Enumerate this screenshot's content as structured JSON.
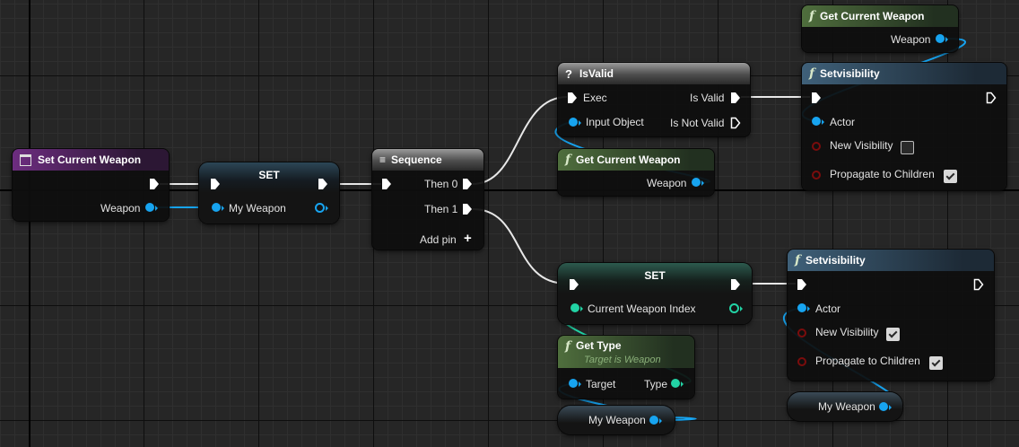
{
  "nodes": {
    "set_current_weapon_event": {
      "title": "Set Current Weapon",
      "icon": "event-icon",
      "out_pin": "Weapon"
    },
    "set_my_weapon": {
      "title": "SET",
      "in_pin": "My Weapon"
    },
    "sequence": {
      "title": "Sequence",
      "icon": "sequence-icon",
      "then0": "Then 0",
      "then1": "Then 1",
      "add_pin": "Add pin"
    },
    "is_valid": {
      "title": "IsValid",
      "icon": "question-icon",
      "exec": "Exec",
      "input_object": "Input Object",
      "is_valid": "Is Valid",
      "is_not_valid": "Is Not Valid"
    },
    "get_current_weapon_1": {
      "title": "Get Current Weapon",
      "icon": "function-icon",
      "out_pin": "Weapon"
    },
    "get_current_weapon_2": {
      "title": "Get Current Weapon",
      "icon": "function-icon",
      "out_pin": "Weapon"
    },
    "set_visibility_1": {
      "title": "Setvisibility",
      "icon": "function-icon",
      "actor": "Actor",
      "new_visibility": "New Visibility",
      "new_visibility_checked": false,
      "propagate": "Propagate to Children",
      "propagate_checked": true
    },
    "set_weapon_index": {
      "title": "SET",
      "in_pin": "Current Weapon Index"
    },
    "set_visibility_2": {
      "title": "Setvisibility",
      "icon": "function-icon",
      "actor": "Actor",
      "new_visibility": "New Visibility",
      "new_visibility_checked": true,
      "propagate": "Propagate to Children",
      "propagate_checked": true
    },
    "get_type": {
      "title": "Get Type",
      "subtitle": "Target is Weapon",
      "icon": "function-icon",
      "target": "Target",
      "type": "Type"
    },
    "my_weapon_var_1": {
      "label": "My Weapon"
    },
    "my_weapon_var_2": {
      "label": "My Weapon"
    }
  },
  "colors": {
    "object_pin": "#17a4f0",
    "byte_pin": "#22d3a5",
    "bool_pin": "#7a0c0c",
    "exec_pin": "#ffffff",
    "event_header": "#6d2d80",
    "pure_header": "#4f6e3d",
    "function_header": "#3f6079"
  }
}
